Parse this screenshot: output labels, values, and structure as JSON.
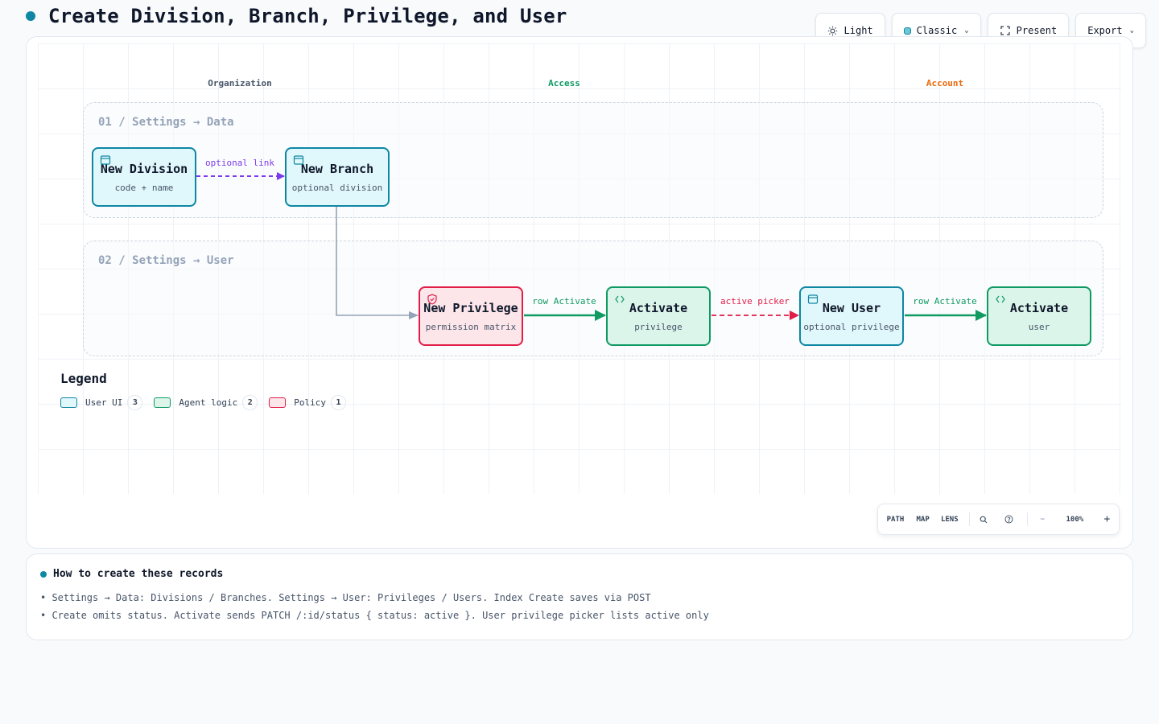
{
  "page": {
    "title": "Create Division, Branch, Privilege, and User",
    "accent": "#0e87a3"
  },
  "toolbar": {
    "light": "Light",
    "theme": "Classic",
    "present": "Present",
    "export": "Export"
  },
  "lanes": [
    {
      "label": "Organization",
      "color": "#475569"
    },
    {
      "label": "Access",
      "color": "#0f9a62"
    },
    {
      "label": "Account",
      "color": "#ea6a0c"
    }
  ],
  "groups": [
    {
      "label": "01 / Settings → Data"
    },
    {
      "label": "02 / Settings → User"
    }
  ],
  "nodes": [
    {
      "title": "New Division",
      "sub": "code + name",
      "kind": "ui",
      "icon": "window-icon"
    },
    {
      "title": "New Branch",
      "sub": "optional division",
      "kind": "ui",
      "icon": "window-icon"
    },
    {
      "title": "New Privilege",
      "sub": "permission matrix",
      "kind": "policy",
      "icon": "shield-icon"
    },
    {
      "title": "Activate",
      "sub": "privilege",
      "kind": "agent",
      "icon": "code-icon"
    },
    {
      "title": "New User",
      "sub": "optional privilege",
      "kind": "ui",
      "icon": "window-icon"
    },
    {
      "title": "Activate",
      "sub": "user",
      "kind": "agent",
      "icon": "code-icon"
    }
  ],
  "edges": [
    {
      "from": "New Division",
      "to": "New Branch",
      "label": "optional link",
      "style": "dashed",
      "color": "#7c3aed"
    },
    {
      "from": "New Branch",
      "to": "New Privilege",
      "label": "",
      "style": "solid",
      "color": "#94a3b8"
    },
    {
      "from": "New Privilege",
      "to": "Activate privilege",
      "label": "row Activate",
      "style": "solid",
      "color": "#0f9a62"
    },
    {
      "from": "Activate privilege",
      "to": "New User",
      "label": "active picker",
      "style": "dashed",
      "color": "#e11d48"
    },
    {
      "from": "New User",
      "to": "Activate user",
      "label": "row Activate",
      "style": "solid",
      "color": "#0f9a62"
    }
  ],
  "legend": {
    "title": "Legend",
    "items": [
      {
        "label": "User UI",
        "count": "3",
        "fill": "#e0f7fb",
        "stroke": "#0e87a3"
      },
      {
        "label": "Agent logic",
        "count": "2",
        "fill": "#dcf5ea",
        "stroke": "#0f9a62"
      },
      {
        "label": "Policy",
        "count": "1",
        "fill": "#fde6ea",
        "stroke": "#e11d48"
      }
    ]
  },
  "controls": {
    "path": "PATH",
    "map": "MAP",
    "lens": "LENS",
    "zoom": "100%",
    "minus": "−",
    "plus": "+"
  },
  "notes": {
    "title": "How to create these records",
    "lines": [
      "• Settings → Data: Divisions / Branches. Settings → User: Privileges / Users. Index Create saves via POST",
      "• Create omits status. Activate sends PATCH /:id/status { status: active }. User privilege picker lists active only"
    ]
  }
}
